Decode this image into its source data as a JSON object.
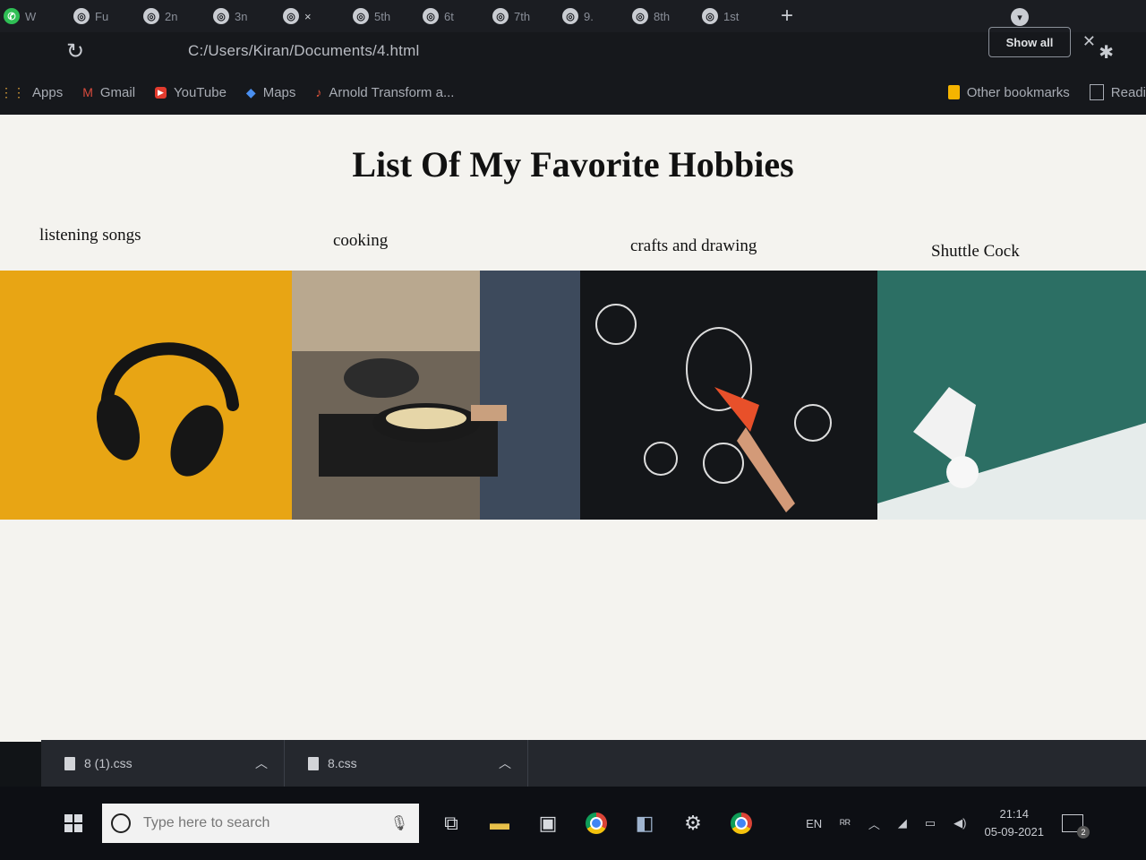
{
  "browser": {
    "tabs": [
      {
        "icon": "whatsapp-icon",
        "label": "W"
      },
      {
        "icon": "globe-icon",
        "label": "Fu"
      },
      {
        "icon": "globe-icon",
        "label": "2n"
      },
      {
        "icon": "globe-icon",
        "label": "3n"
      },
      {
        "icon": "globe-icon",
        "label": "×"
      },
      {
        "icon": "globe-icon",
        "label": "5th"
      },
      {
        "icon": "globe-icon",
        "label": "6t"
      },
      {
        "icon": "globe-icon",
        "label": "7th"
      },
      {
        "icon": "globe-icon",
        "label": "9."
      },
      {
        "icon": "globe-icon",
        "label": "8th"
      },
      {
        "icon": "globe-icon",
        "label": "1st"
      }
    ],
    "new_tab": "+",
    "address": "C:/Users/Kiran/Documents/4.html",
    "reload": "↻",
    "bookmarks": [
      {
        "name": "apps",
        "icon": "apps-icon",
        "glyph": "⋮⋮",
        "label": "Apps"
      },
      {
        "name": "gmail",
        "icon": "gmail-icon",
        "glyph": "M",
        "label": "Gmail"
      },
      {
        "name": "youtube",
        "icon": "youtube-icon",
        "glyph": "▶",
        "label": "YouTube"
      },
      {
        "name": "maps",
        "icon": "maps-icon",
        "glyph": "◆",
        "label": "Maps"
      },
      {
        "name": "arnold",
        "icon": "arnold-icon",
        "glyph": "♪",
        "label": "Arnold Transform a..."
      }
    ],
    "other_bookmarks": "Other bookmarks",
    "reading_list": "Readi"
  },
  "page": {
    "title": "List Of My Favorite Hobbies",
    "hobbies": [
      {
        "label": "listening songs",
        "image": "headphones-image"
      },
      {
        "label": "cooking",
        "image": "cooking-image"
      },
      {
        "label": "crafts and drawing",
        "image": "drawing-image"
      },
      {
        "label": "Shuttle Cock",
        "image": "shuttlecock-image"
      }
    ]
  },
  "downloads": {
    "items": [
      {
        "file": "8 (1).css"
      },
      {
        "file": "8.css"
      }
    ],
    "show_all": "Show all"
  },
  "taskbar": {
    "search_placeholder": "Type here to search",
    "language": "EN",
    "time": "21:14",
    "date": "05-09-2021",
    "notification_count": "2"
  }
}
